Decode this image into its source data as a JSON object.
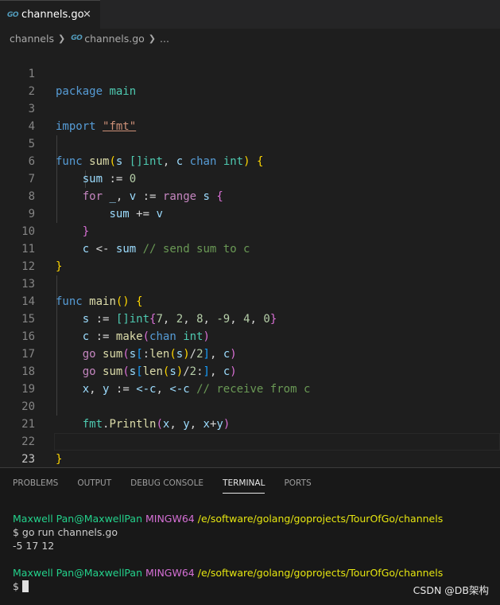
{
  "tab": {
    "title": "channels.go",
    "icon": "go-file-icon",
    "icon_text": "GO"
  },
  "breadcrumb": {
    "folder": "channels",
    "file": "channels.go",
    "more": "..."
  },
  "editor": {
    "line_numbers": [
      "1",
      "2",
      "3",
      "4",
      "5",
      "6",
      "7",
      "8",
      "9",
      "10",
      "11",
      "12",
      "13",
      "14",
      "15",
      "16",
      "17",
      "18",
      "19",
      "20",
      "21",
      "22",
      "23"
    ],
    "code": {
      "l1_kw": "package",
      "l1_name": "main",
      "l3_kw": "import",
      "l3_str": "\"fmt\"",
      "l5_kw": "func",
      "l5_fn": "sum",
      "l5_p1": "s",
      "l5_t1": "[]int",
      "l5_p2": "c",
      "l5_chan": "chan",
      "l5_t2": "int",
      "l6_var": "sum",
      "l6_op": ":=",
      "l6_num": "0",
      "l7_for": "for",
      "l7_blank": "_",
      "l7_v": "v",
      "l7_op": ":=",
      "l7_range": "range",
      "l7_s": "s",
      "l8_sum": "sum",
      "l8_op": "+=",
      "l8_v": "v",
      "l10_c": "c",
      "l10_op": "<-",
      "l10_sum": "sum",
      "l10_comment": "// send sum to c",
      "l13_kw": "func",
      "l13_fn": "main",
      "l14_s": "s",
      "l14_op": ":=",
      "l14_type": "[]int",
      "l14_n1": "7",
      "l14_n2": "2",
      "l14_n3": "8",
      "l14_n4": "-9",
      "l14_n5": "4",
      "l14_n6": "0",
      "l15_c": "c",
      "l15_op": ":=",
      "l15_make": "make",
      "l15_chan": "chan",
      "l15_int": "int",
      "l16_go": "go",
      "l16_sum": "sum",
      "l16_s": "s",
      "l16_len": "len",
      "l16_s2": "s",
      "l16_n": "2",
      "l16_c": "c",
      "l17_go": "go",
      "l17_sum": "sum",
      "l17_s": "s",
      "l17_len": "len",
      "l17_s2": "s",
      "l17_n": "2",
      "l17_c": "c",
      "l18_x": "x",
      "l18_y": "y",
      "l18_op": ":=",
      "l18_recv1": "<-c",
      "l18_recv2": "<-c",
      "l18_comment": "// receive from c",
      "l20_fmt": "fmt",
      "l20_fn": "Println",
      "l20_x": "x",
      "l20_y": "y",
      "l20_x2": "x",
      "l20_y2": "y"
    }
  },
  "panel": {
    "tabs": [
      "PROBLEMS",
      "OUTPUT",
      "DEBUG CONSOLE",
      "TERMINAL",
      "PORTS"
    ],
    "active_tab": "TERMINAL"
  },
  "terminal": {
    "user": "Maxwell Pan@MaxwellPan",
    "system": "MINGW64",
    "path": "/e/software/golang/goprojects/TourOfGo/channels",
    "command": "$ go run channels.go",
    "output": "-5 17 12",
    "prompt": "$"
  },
  "watermark": "CSDN @DB架构",
  "colors": {
    "keyword": "#569cd6",
    "control": "#c586c0",
    "function": "#dcdcaa",
    "type": "#4ec9b0",
    "variable": "#9cdcfe",
    "number": "#b5cea8",
    "string": "#ce9178",
    "comment": "#6a9955",
    "terminal_user": "#23d18b",
    "terminal_system": "#d670d6",
    "terminal_path": "#e5e510"
  }
}
